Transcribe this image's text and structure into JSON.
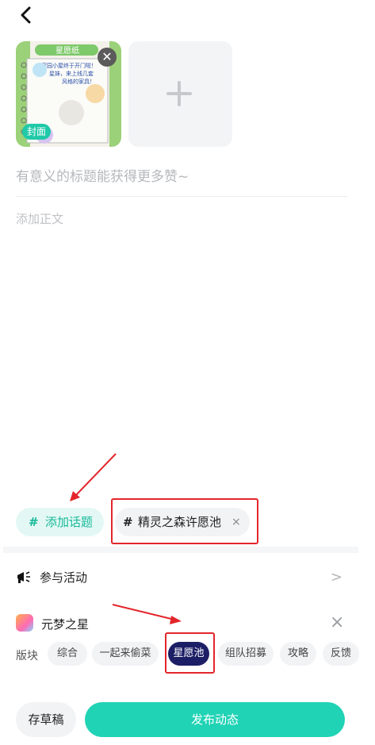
{
  "editor": {
    "cover_label": "封面",
    "image_text": [
      "家园小屋终于开门啦！",
      "星妹，来上线几套",
      "风格的家具！"
    ],
    "image_header": "星愿纸",
    "title_placeholder": "有意义的标题能获得更多赞~",
    "body_placeholder": "添加正文"
  },
  "topics": {
    "add_hash": "#",
    "add_label": "添加话题",
    "selected_hash": "#",
    "selected_label": "精灵之森许愿池",
    "remove": "×"
  },
  "activity": {
    "label": "参与活动",
    "chevron": ">"
  },
  "game": {
    "name": "元梦之星",
    "close": "×"
  },
  "board": {
    "label": "版块",
    "chips": [
      "综合",
      "一起来偷菜",
      "星愿池",
      "组队招募",
      "攻略",
      "反馈"
    ],
    "selected": "星愿池"
  },
  "footer": {
    "draft": "存草稿",
    "publish": "发布动态"
  },
  "colors": {
    "accent": "#20d3b5",
    "highlight_box": "#e3262b",
    "selected_chip": "#1d1f66"
  }
}
